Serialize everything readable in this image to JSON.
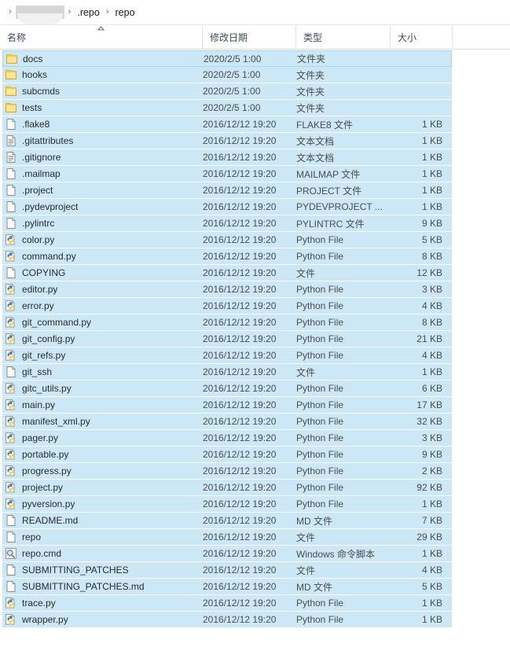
{
  "window": {
    "type": "file-explorer"
  },
  "breadcrumb": {
    "leading_separator": "›",
    "separator": "›",
    "items": [
      {
        "label": "",
        "redacted": true
      },
      {
        "label": ".repo",
        "redacted": false
      },
      {
        "label": "repo",
        "redacted": false
      }
    ]
  },
  "columns": {
    "name": "名称",
    "date_modified": "修改日期",
    "type": "类型",
    "size": "大小",
    "sort_column": "名称",
    "sort_direction": "ascending"
  },
  "colors": {
    "selection_fill": "#cce8f6",
    "selection_border": "#a8d8ef",
    "header_text": "#3a4a5a",
    "folder_icon": "#ffd75e",
    "python_blue": "#3c78a9",
    "python_yellow": "#f5d247"
  },
  "files": [
    {
      "name": "docs",
      "date": "2020/2/5 1:00",
      "type": "文件夹",
      "size": "",
      "icon": "folder-icon",
      "selected": true,
      "focused": true
    },
    {
      "name": "hooks",
      "date": "2020/2/5 1:00",
      "type": "文件夹",
      "size": "",
      "icon": "folder-icon",
      "selected": true,
      "focused": false
    },
    {
      "name": "subcmds",
      "date": "2020/2/5 1:00",
      "type": "文件夹",
      "size": "",
      "icon": "folder-icon",
      "selected": true,
      "focused": false
    },
    {
      "name": "tests",
      "date": "2020/2/5 1:00",
      "type": "文件夹",
      "size": "",
      "icon": "folder-icon",
      "selected": true,
      "focused": false
    },
    {
      "name": ".flake8",
      "date": "2016/12/12 19:20",
      "type": "FLAKE8 文件",
      "size": "1 KB",
      "icon": "blank-file-icon",
      "selected": true,
      "focused": false
    },
    {
      "name": ".gitattributes",
      "date": "2016/12/12 19:20",
      "type": "文本文档",
      "size": "1 KB",
      "icon": "text-document-icon",
      "selected": true,
      "focused": false
    },
    {
      "name": ".gitignore",
      "date": "2016/12/12 19:20",
      "type": "文本文档",
      "size": "1 KB",
      "icon": "text-document-icon",
      "selected": true,
      "focused": false
    },
    {
      "name": ".mailmap",
      "date": "2016/12/12 19:20",
      "type": "MAILMAP 文件",
      "size": "1 KB",
      "icon": "blank-file-icon",
      "selected": true,
      "focused": false
    },
    {
      "name": ".project",
      "date": "2016/12/12 19:20",
      "type": "PROJECT 文件",
      "size": "1 KB",
      "icon": "blank-file-icon",
      "selected": true,
      "focused": false
    },
    {
      "name": ".pydevproject",
      "date": "2016/12/12 19:20",
      "type": "PYDEVPROJECT ...",
      "size": "1 KB",
      "icon": "blank-file-icon",
      "selected": true,
      "focused": false
    },
    {
      "name": ".pylintrc",
      "date": "2016/12/12 19:20",
      "type": "PYLINTRC 文件",
      "size": "9 KB",
      "icon": "blank-file-icon",
      "selected": true,
      "focused": false
    },
    {
      "name": "color.py",
      "date": "2016/12/12 19:20",
      "type": "Python File",
      "size": "5 KB",
      "icon": "python-file-icon",
      "selected": true,
      "focused": false
    },
    {
      "name": "command.py",
      "date": "2016/12/12 19:20",
      "type": "Python File",
      "size": "8 KB",
      "icon": "python-file-icon",
      "selected": true,
      "focused": false
    },
    {
      "name": "COPYING",
      "date": "2016/12/12 19:20",
      "type": "文件",
      "size": "12 KB",
      "icon": "blank-file-icon",
      "selected": true,
      "focused": false
    },
    {
      "name": "editor.py",
      "date": "2016/12/12 19:20",
      "type": "Python File",
      "size": "3 KB",
      "icon": "python-file-icon",
      "selected": true,
      "focused": false
    },
    {
      "name": "error.py",
      "date": "2016/12/12 19:20",
      "type": "Python File",
      "size": "4 KB",
      "icon": "python-file-icon",
      "selected": true,
      "focused": false
    },
    {
      "name": "git_command.py",
      "date": "2016/12/12 19:20",
      "type": "Python File",
      "size": "8 KB",
      "icon": "python-file-icon",
      "selected": true,
      "focused": false
    },
    {
      "name": "git_config.py",
      "date": "2016/12/12 19:20",
      "type": "Python File",
      "size": "21 KB",
      "icon": "python-file-icon",
      "selected": true,
      "focused": false
    },
    {
      "name": "git_refs.py",
      "date": "2016/12/12 19:20",
      "type": "Python File",
      "size": "4 KB",
      "icon": "python-file-icon",
      "selected": true,
      "focused": false
    },
    {
      "name": "git_ssh",
      "date": "2016/12/12 19:20",
      "type": "文件",
      "size": "1 KB",
      "icon": "blank-file-icon",
      "selected": true,
      "focused": false
    },
    {
      "name": "gitc_utils.py",
      "date": "2016/12/12 19:20",
      "type": "Python File",
      "size": "6 KB",
      "icon": "python-file-icon",
      "selected": true,
      "focused": false
    },
    {
      "name": "main.py",
      "date": "2016/12/12 19:20",
      "type": "Python File",
      "size": "17 KB",
      "icon": "python-file-icon",
      "selected": true,
      "focused": false
    },
    {
      "name": "manifest_xml.py",
      "date": "2016/12/12 19:20",
      "type": "Python File",
      "size": "32 KB",
      "icon": "python-file-icon",
      "selected": true,
      "focused": false
    },
    {
      "name": "pager.py",
      "date": "2016/12/12 19:20",
      "type": "Python File",
      "size": "3 KB",
      "icon": "python-file-icon",
      "selected": true,
      "focused": false
    },
    {
      "name": "portable.py",
      "date": "2016/12/12 19:20",
      "type": "Python File",
      "size": "9 KB",
      "icon": "python-file-icon",
      "selected": true,
      "focused": false
    },
    {
      "name": "progress.py",
      "date": "2016/12/12 19:20",
      "type": "Python File",
      "size": "2 KB",
      "icon": "python-file-icon",
      "selected": true,
      "focused": false
    },
    {
      "name": "project.py",
      "date": "2016/12/12 19:20",
      "type": "Python File",
      "size": "92 KB",
      "icon": "python-file-icon",
      "selected": true,
      "focused": false
    },
    {
      "name": "pyversion.py",
      "date": "2016/12/12 19:20",
      "type": "Python File",
      "size": "1 KB",
      "icon": "python-file-icon",
      "selected": true,
      "focused": false
    },
    {
      "name": "README.md",
      "date": "2016/12/12 19:20",
      "type": "MD 文件",
      "size": "7 KB",
      "icon": "blank-file-icon",
      "selected": true,
      "focused": false
    },
    {
      "name": "repo",
      "date": "2016/12/12 19:20",
      "type": "文件",
      "size": "29 KB",
      "icon": "blank-file-icon",
      "selected": true,
      "focused": false
    },
    {
      "name": "repo.cmd",
      "date": "2016/12/12 19:20",
      "type": "Windows 命令脚本",
      "size": "1 KB",
      "icon": "command-script-icon",
      "selected": true,
      "focused": false
    },
    {
      "name": "SUBMITTING_PATCHES",
      "date": "2016/12/12 19:20",
      "type": "文件",
      "size": "4 KB",
      "icon": "blank-file-icon",
      "selected": true,
      "focused": false
    },
    {
      "name": "SUBMITTING_PATCHES.md",
      "date": "2016/12/12 19:20",
      "type": "MD 文件",
      "size": "5 KB",
      "icon": "blank-file-icon",
      "selected": true,
      "focused": false
    },
    {
      "name": "trace.py",
      "date": "2016/12/12 19:20",
      "type": "Python File",
      "size": "1 KB",
      "icon": "python-file-icon",
      "selected": true,
      "focused": false
    },
    {
      "name": "wrapper.py",
      "date": "2016/12/12 19:20",
      "type": "Python File",
      "size": "1 KB",
      "icon": "python-file-icon",
      "selected": true,
      "focused": false
    }
  ]
}
